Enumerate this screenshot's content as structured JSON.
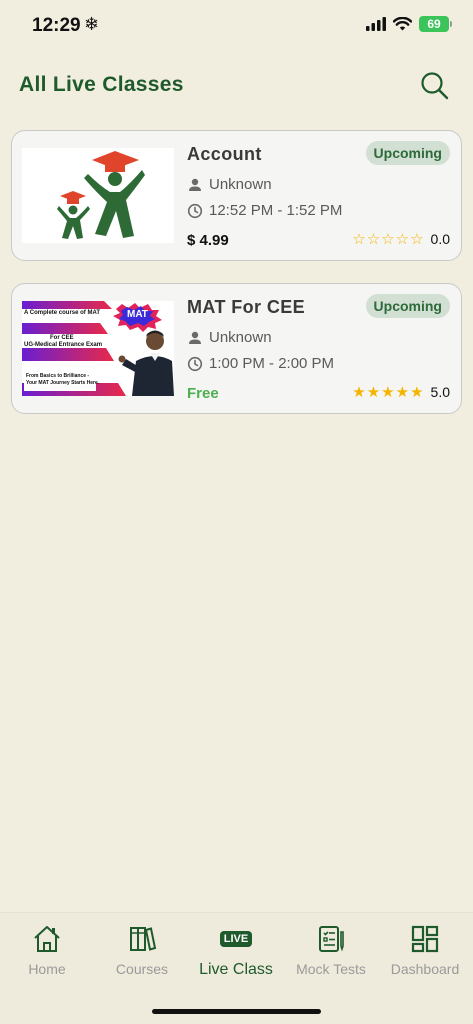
{
  "status_bar": {
    "time": "12:29",
    "battery": "69"
  },
  "header": {
    "title": "All Live Classes"
  },
  "classes": [
    {
      "title": "Account",
      "status": "Upcoming",
      "instructor": "Unknown",
      "time": "12:52 PM - 1:52 PM",
      "price": "$ 4.99",
      "rating": "0.0",
      "stars_filled": 0
    },
    {
      "title": "MAT For CEE",
      "status": "Upcoming",
      "instructor": "Unknown",
      "time": "1:00 PM - 2:00 PM",
      "price": "Free",
      "rating": "5.0",
      "stars_filled": 5,
      "thumbnail": {
        "line1": "A Complete course of MAT",
        "line2": "For CEE",
        "line3": "UG-Medical Entrance Exam",
        "line4": "From Basics to Brilliance -",
        "line5": "Your MAT Journey Starts Here.",
        "badge": "MAT"
      }
    }
  ],
  "nav": {
    "home": "Home",
    "courses": "Courses",
    "live": "Live Class",
    "live_badge": "LIVE",
    "mock": "Mock Tests",
    "dashboard": "Dashboard"
  },
  "colors": {
    "background": "#f1eee0",
    "brand_green": "#1f5a2c",
    "badge_bg": "#d2dfd3",
    "star": "#f4b400",
    "free": "#4caf50"
  }
}
